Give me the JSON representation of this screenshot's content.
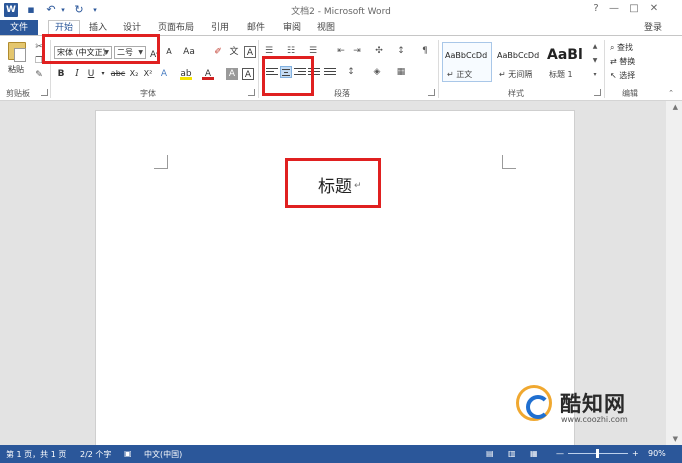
{
  "title_bar": {
    "window_title": "文档2 - Microsoft Word",
    "help": "?",
    "minimize": "—",
    "maximize": "□",
    "close": "✕"
  },
  "tabs": {
    "file": "文件",
    "items": [
      "开始",
      "插入",
      "设计",
      "页面布局",
      "引用",
      "邮件",
      "审阅",
      "视图"
    ],
    "login": "登录"
  },
  "ribbon": {
    "clipboard": {
      "paste_label": "粘贴",
      "group_label": "剪贴板"
    },
    "font": {
      "font_name": "宋体 (中文正》",
      "font_size": "二号",
      "case_btn": "Aa",
      "bold": "B",
      "italic": "I",
      "underline": "U",
      "strike": "abc",
      "subscript": "X₂",
      "superscript": "X²",
      "text_effect": "A",
      "font_color": "A",
      "char_shading": "A",
      "char_border": "A",
      "group_label": "字体"
    },
    "paragraph": {
      "group_label": "段落"
    },
    "styles": {
      "items": [
        {
          "sample": "AaBbCcDd",
          "name": "↵ 正文"
        },
        {
          "sample": "AaBbCcDd",
          "name": "↵ 无间隔"
        },
        {
          "sample": "AaBl",
          "name": "标题 1"
        }
      ],
      "group_label": "样式"
    },
    "editing": {
      "find": "查找",
      "replace": "替换",
      "select": "选择",
      "group_label": "编辑"
    }
  },
  "document": {
    "heading": "标题",
    "paragraph_mark": "↵"
  },
  "watermark": {
    "brand": "酷知网",
    "url": "www.coozhi.com"
  },
  "status_bar": {
    "page": "第 1 页，共 1 页",
    "words": "2/2 个字",
    "language": "中文(中国)",
    "zoom": "90%"
  }
}
